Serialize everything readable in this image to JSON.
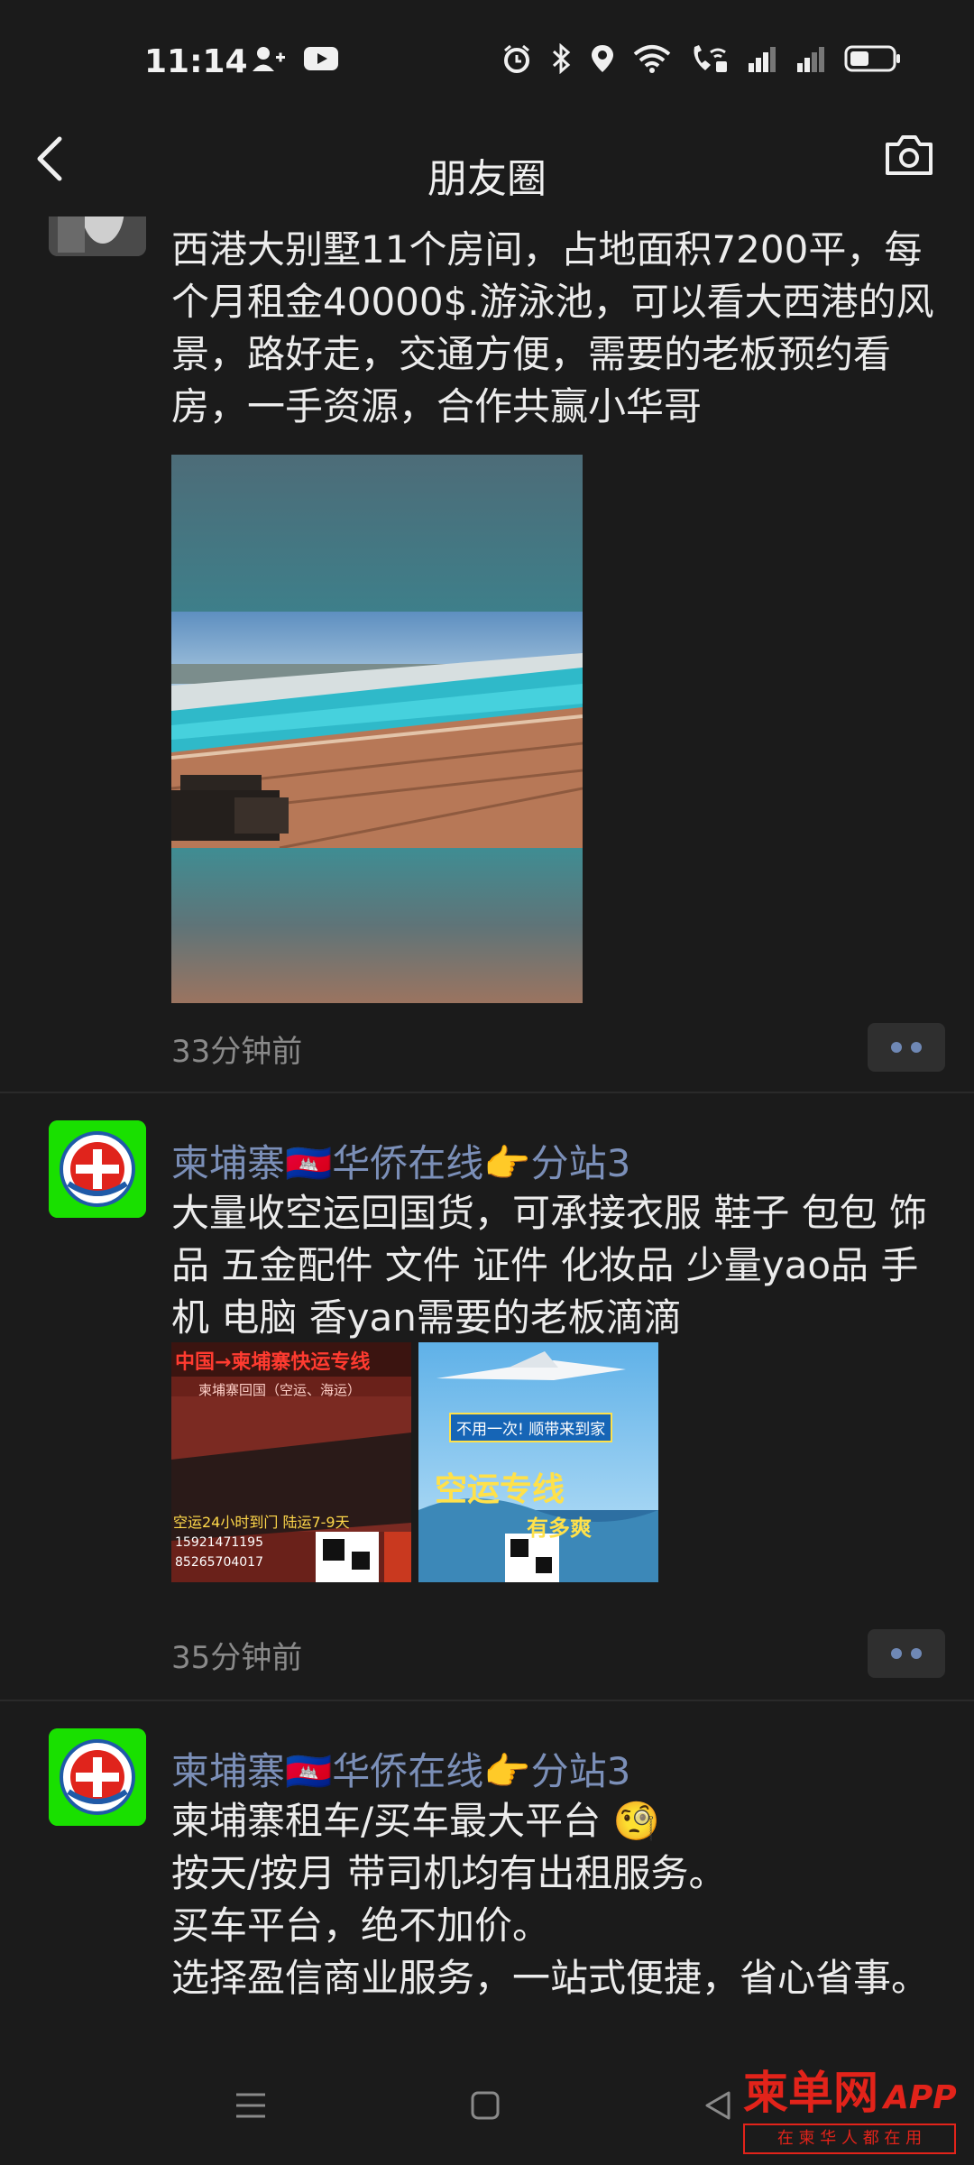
{
  "status_bar": {
    "time": "11:14"
  },
  "nav": {
    "title": "朋友圈"
  },
  "posts": [
    {
      "text": "西港大别墅11个房间，占地面积7200平，每个月租金40000$.游泳池，可以看大西港的风景，路好走，交通方便，需要的老板预约看房，一手资源，合作共赢小华哥",
      "time_ago": "33分钟前"
    },
    {
      "author": "柬埔寨🇰🇭华侨在线👉分站3",
      "text": "大量收空运回国货，可承接衣服 鞋子 包包 饰品 五金配件 文件 证件 化妆品 少量yao品 手机 电脑 香yan需要的老板滴滴",
      "time_ago": "35分钟前",
      "images": [
        {
          "title": "中国→柬埔寨快运专线",
          "line1": "柬埔寨回国（空运、海运）",
          "line2": "空运24小时到门  陆运7-9天",
          "phone1": "15921471195",
          "phone2": "85265704017"
        },
        {
          "banner": "不用一次!  顺带来到家",
          "headline": "空运专线",
          "slogan": "有多爽"
        }
      ]
    },
    {
      "author": "柬埔寨🇰🇭华侨在线👉分站3",
      "lines": [
        "柬埔寨租车/买车最大平台 🧐",
        "按天/按月 带司机均有出租服务。",
        "买车平台，绝不加价。",
        "选择盈信商业服务，一站式便捷，省心省事。"
      ]
    }
  ],
  "watermark": {
    "brand": "柬单网",
    "app": "APP",
    "slogan": "在 柬 华 人 都 在 用"
  },
  "colors": {
    "background": "#1b1b1b",
    "author_link": "#7b8fb8",
    "avatar_green": "#19e000",
    "watermark_red": "#e2231a"
  }
}
